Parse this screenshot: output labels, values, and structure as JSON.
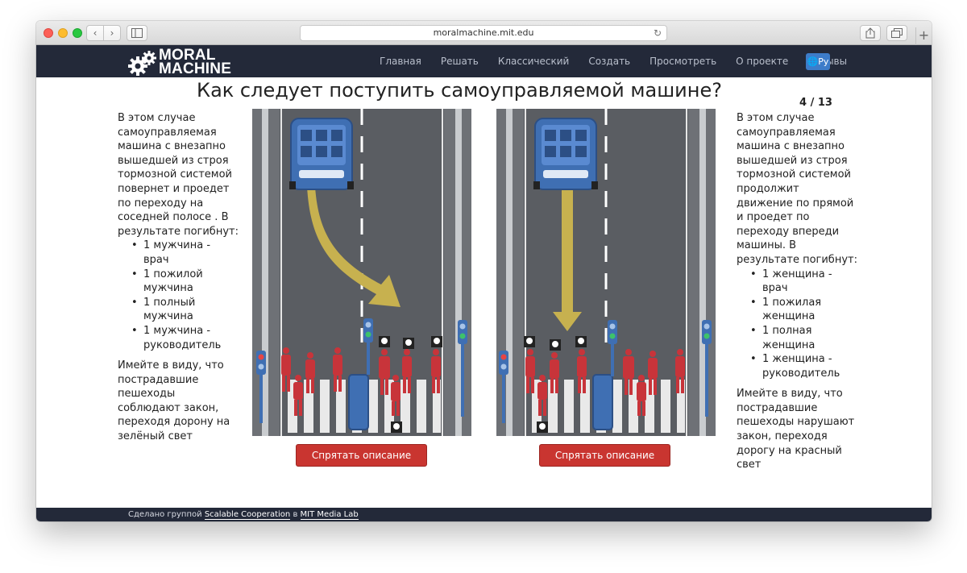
{
  "browser": {
    "url": "moralmachine.mit.edu",
    "buttons": {
      "back": "‹",
      "forward": "›",
      "new_tab": "+"
    }
  },
  "header": {
    "logo_line1": "MORAL",
    "logo_line2": "MACHINE",
    "nav": [
      "Главная",
      "Решать",
      "Классический",
      "Создать",
      "Просмотреть",
      "О проекте",
      "Отзывы"
    ],
    "lang": "Ру"
  },
  "main": {
    "question": "Как следует поступить самоуправляемой машине?",
    "counter": "4 / 13",
    "left": {
      "intro": "В этом случае самоуправляемая машина с внезапно вышедшей из строя тормозной системой повернет и проедет по переходу на соседней полосе . В результате погибнут:",
      "victims": [
        "1 мужчина - врач",
        "1 пожилой мужчина",
        "1 полный мужчина",
        "1 мужчина - руководитель"
      ],
      "note": "Имейте в виду, что пострадавшие пешеходы соблюдают закон, переходя дорону на зелёный свет",
      "hide_button": "Спрятать описание"
    },
    "right": {
      "intro": "В этом случае самоуправляемая машина с внезапно вышедшей из строя тормозной системой продолжит движение по прямой и проедет по переходу впереди машины. В результате погибнут:",
      "victims": [
        "1 женщина - врач",
        "1 пожилая женщина",
        "1 полная женщина",
        "1 женщина - руководитель"
      ],
      "note": "Имейте в виду, что пострадавшие пешеходы нарушают закон, переходя дорогу на красный свет",
      "hide_button": "Спрятать описание"
    }
  },
  "footer": {
    "prefix": "Сделано группой",
    "group": "Scalable Cooperation",
    "mid": "в",
    "lab": "MIT Media Lab"
  },
  "colors": {
    "header_bg": "#232939",
    "button_red": "#c93530",
    "pedestrian_red": "#c8343a",
    "car_blue": "#3f6fb3",
    "arrow_yellow": "#c7b14f"
  }
}
